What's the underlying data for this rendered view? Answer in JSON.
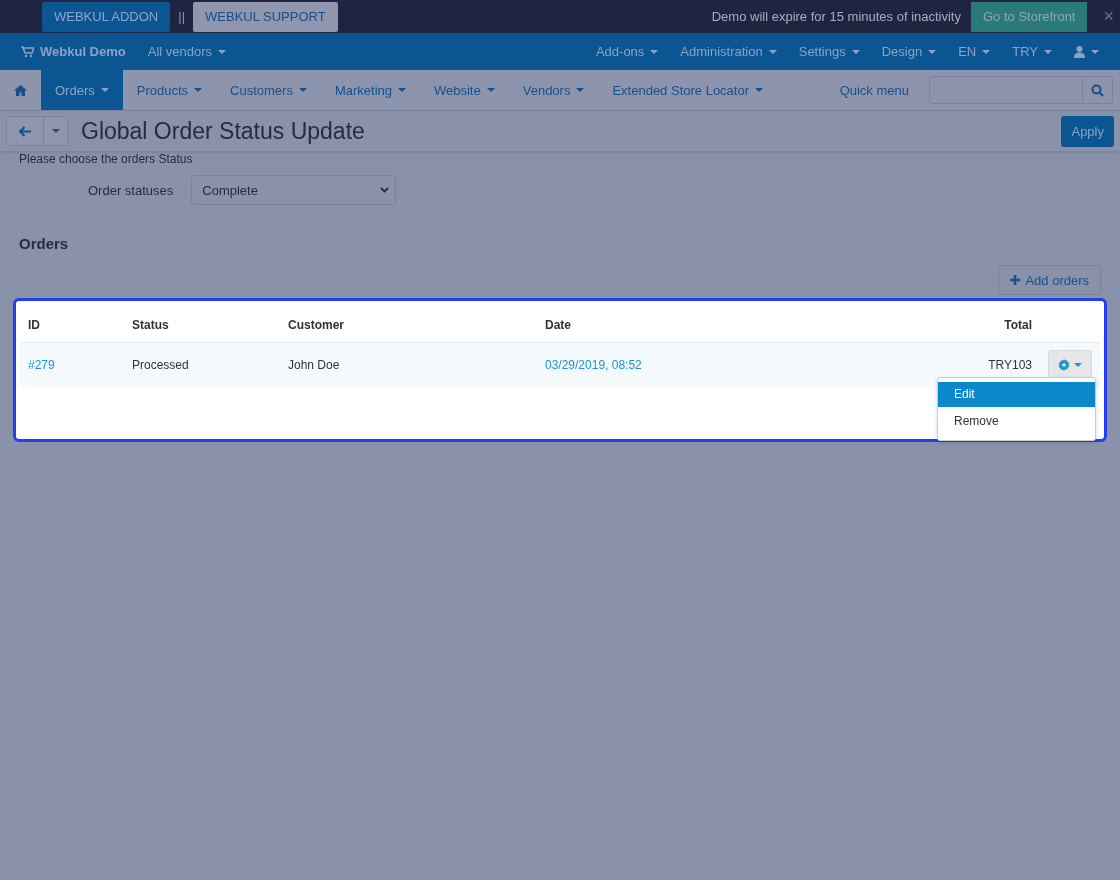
{
  "top_bar": {
    "buttons": [
      {
        "label": "WEBKUL ADDON",
        "selected": true
      },
      {
        "label": "WEBKUL SUPPORT",
        "selected": false
      }
    ],
    "separator": "||",
    "notice": "Demo will expire for 15 minutes of inactivity",
    "storefront_button": "Go to Storefront",
    "close": "×"
  },
  "main_nav": {
    "brand": "Webkul Demo",
    "vendor_menu": "All vendors",
    "items": [
      "Add-ons",
      "Administration",
      "Settings",
      "Design",
      "EN",
      "TRY"
    ]
  },
  "sub_nav": {
    "items": [
      {
        "label": "Orders",
        "selected": true
      },
      {
        "label": "Products",
        "selected": false
      },
      {
        "label": "Customers",
        "selected": false
      },
      {
        "label": "Marketing",
        "selected": false
      },
      {
        "label": "Website",
        "selected": false
      },
      {
        "label": "Vendors",
        "selected": false
      },
      {
        "label": "Extended Store Locator",
        "selected": false
      }
    ],
    "quick_menu": "Quick menu"
  },
  "title_bar": {
    "title": "Global Order Status Update",
    "apply": "Apply"
  },
  "form": {
    "instruction": "Please choose the orders Status",
    "label": "Order statuses",
    "value": "Complete"
  },
  "orders": {
    "heading": "Orders",
    "add_button": "Add orders",
    "columns": [
      "ID",
      "Status",
      "Customer",
      "Date",
      "Total"
    ],
    "rows": [
      {
        "id": "#279",
        "status": "Processed",
        "customer": "John Doe",
        "date": "03/29/2019, 08:52",
        "total": "TRY103"
      }
    ],
    "menu": [
      {
        "label": "Edit",
        "selected": true
      },
      {
        "label": "Remove",
        "selected": false
      }
    ]
  }
}
